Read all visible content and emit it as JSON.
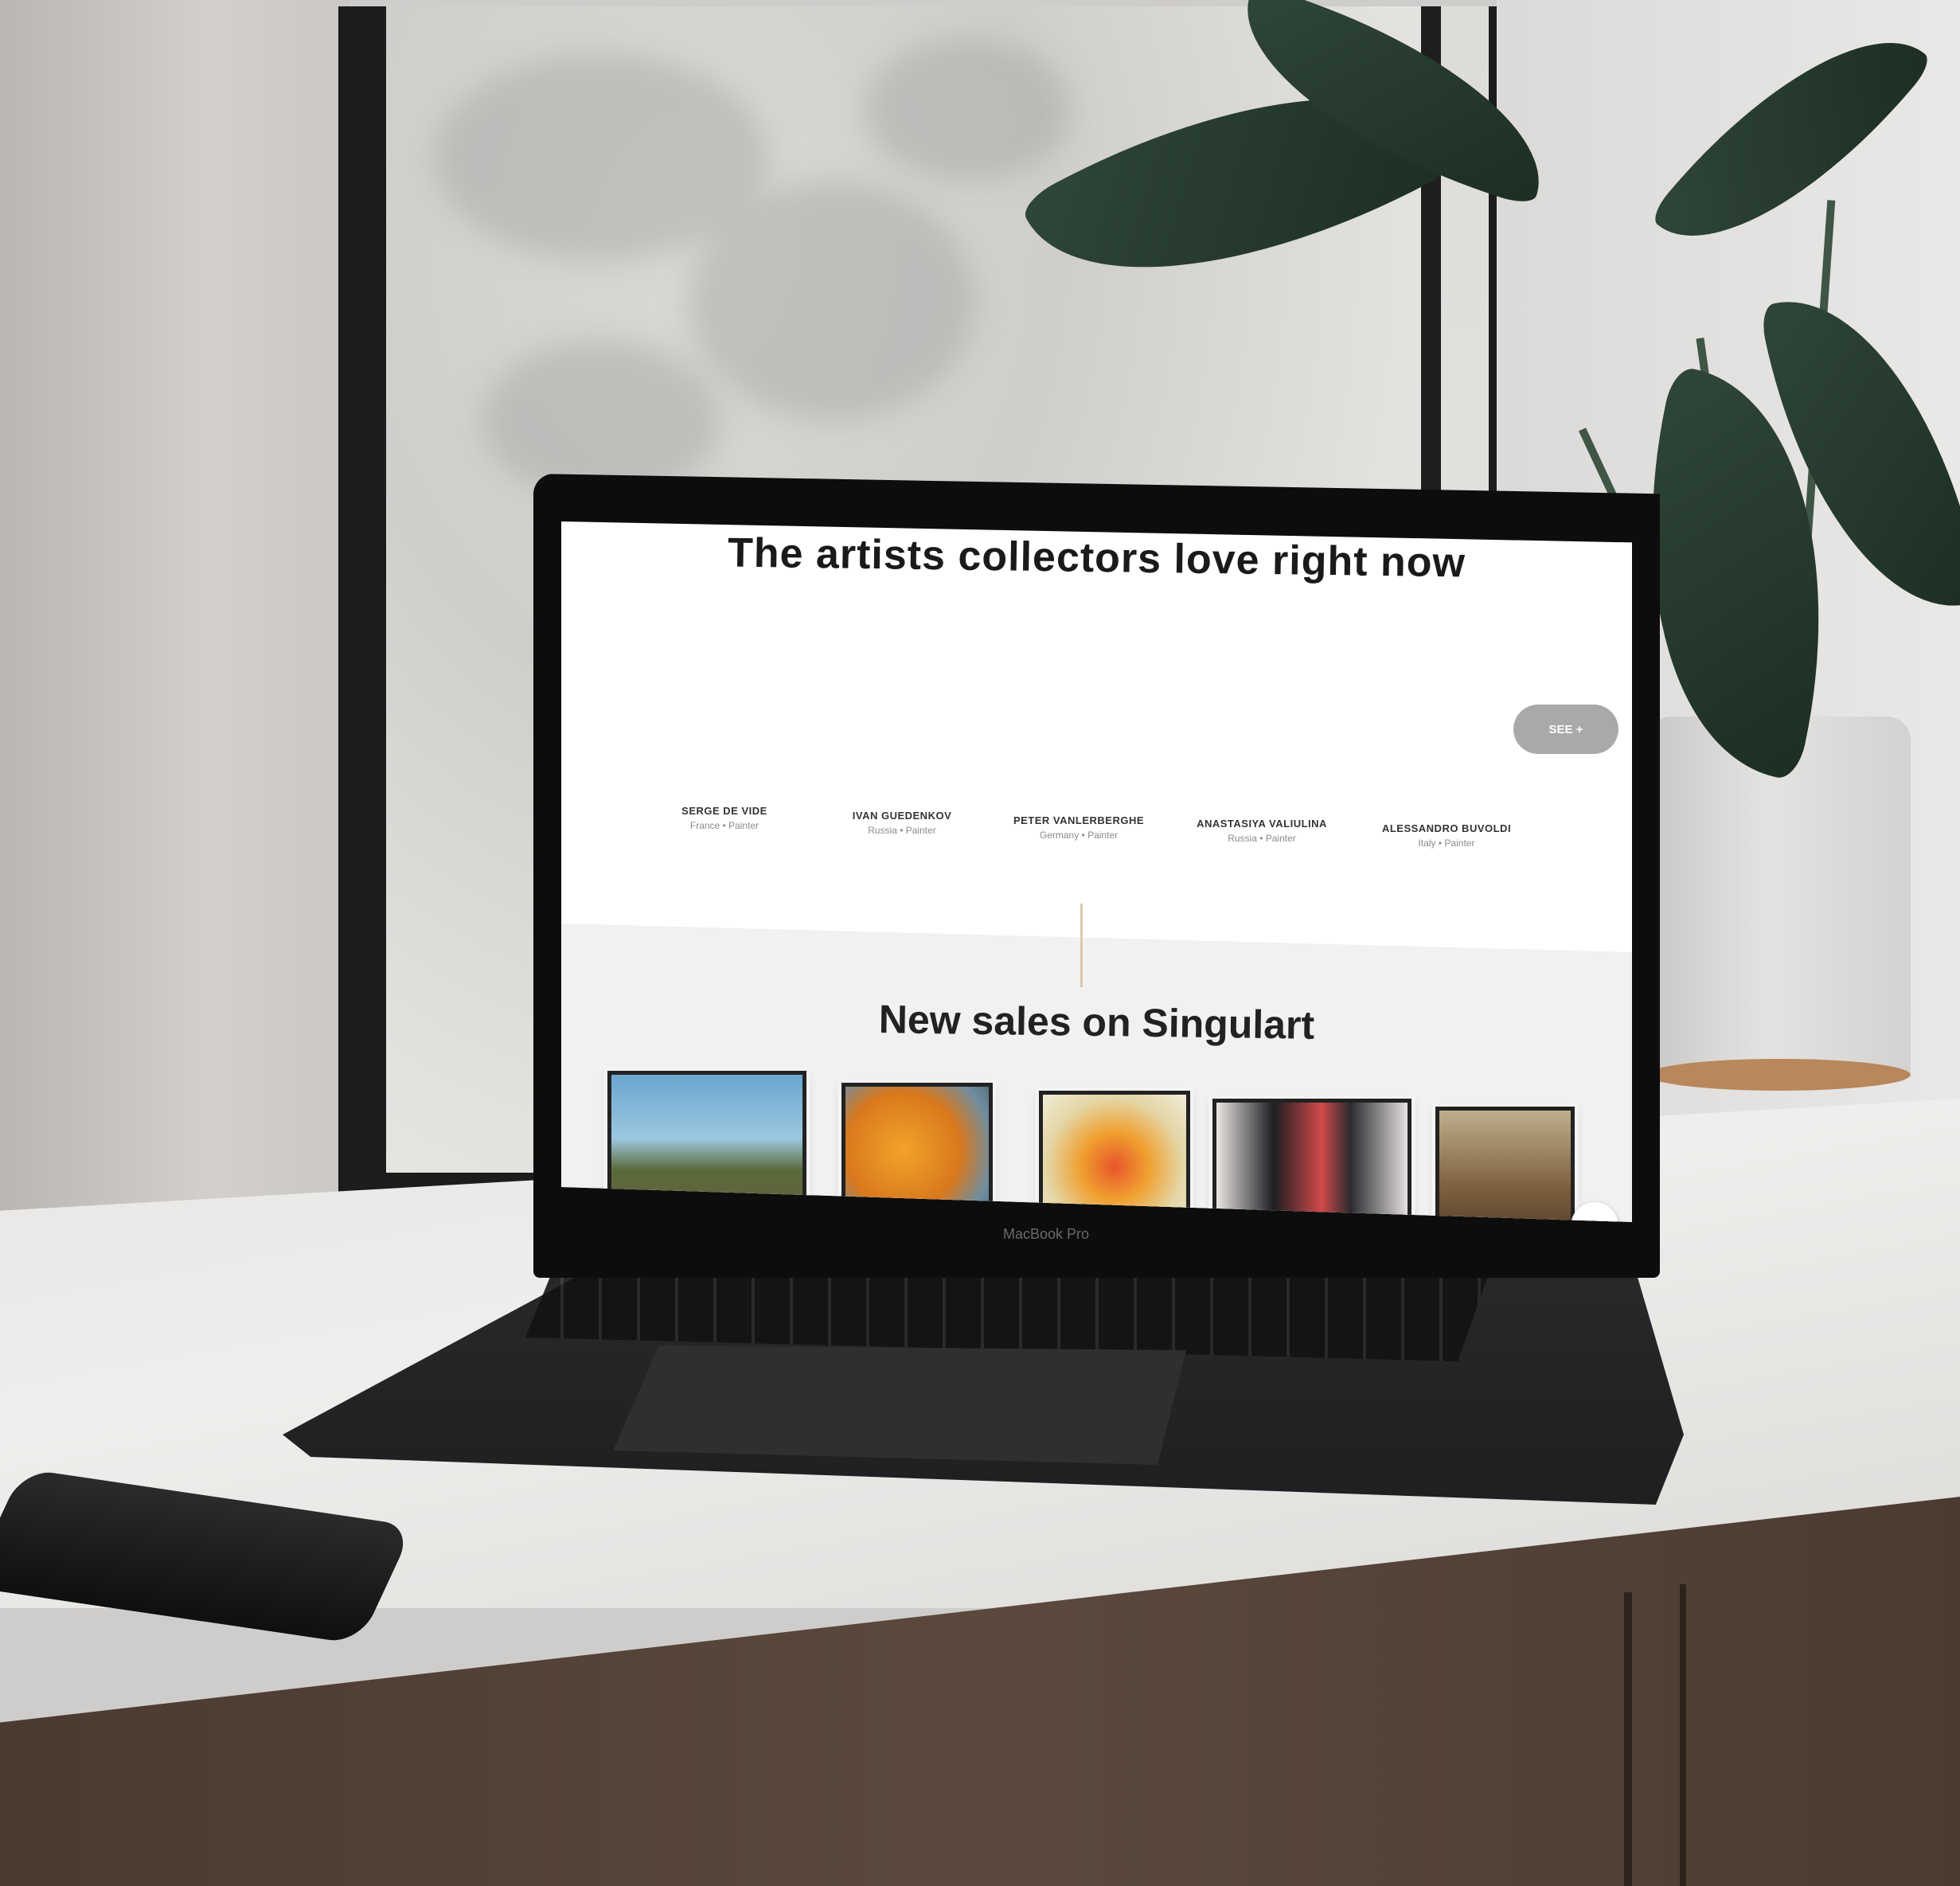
{
  "screen": {
    "title": "The artists collectors love right now",
    "see_all_button": "SEE +",
    "artists": [
      {
        "name": "SERGE DE VIDE",
        "country": "France • Painter"
      },
      {
        "name": "IVAN GUEDENKOV",
        "country": "Russia • Painter"
      },
      {
        "name": "PETER VANLERBERGHE",
        "country": "Germany • Painter"
      },
      {
        "name": "ANASTASIYA VALIULINA",
        "country": "Russia • Painter"
      },
      {
        "name": "ALESSANDRO BUVOLDI",
        "country": "Italy • Painter"
      }
    ],
    "section_title": "New sales on Singulart",
    "artworks": [
      {
        "subject": "mountain landscape"
      },
      {
        "subject": "orange abstract"
      },
      {
        "subject": "flower bouquet"
      },
      {
        "subject": "figures painting"
      },
      {
        "subject": "interior portrait"
      }
    ]
  },
  "device": {
    "model_label": "MacBook Pro"
  },
  "colors": {
    "accent": "#e0c7a9",
    "button": "#a9a9a9",
    "band": "#f1f1f1"
  }
}
